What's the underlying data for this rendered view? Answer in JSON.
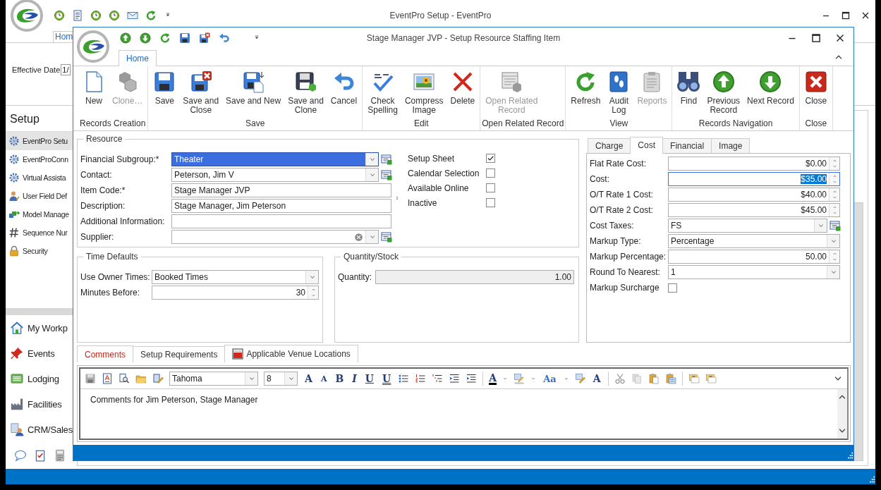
{
  "background_window": {
    "title": "EventPro Setup - EventPro",
    "tab": "Hom",
    "effective_date_label": "Effective Date",
    "effective_date_value": "1/",
    "sidebar_title": "Setup",
    "setup_items": [
      {
        "label": "EventPro Setu",
        "selected": true
      },
      {
        "label": "EventProConn",
        "selected": false
      },
      {
        "label": "Virtual Assista",
        "selected": false
      },
      {
        "label": "User Field Def",
        "selected": false
      },
      {
        "label": "Model Manage",
        "selected": false
      },
      {
        "label": "Sequence Nur",
        "selected": false
      },
      {
        "label": "Security",
        "selected": false
      }
    ],
    "nav_items": [
      "My Workp",
      "Events",
      "Lodging",
      "Facilities",
      "CRM/Sales"
    ]
  },
  "dialog": {
    "title": "Stage Manager JVP - Setup Resource Staffing Item",
    "tabs": [
      {
        "label": "Home",
        "selected": true
      }
    ],
    "ribbon": [
      {
        "label": "Records Creation",
        "buttons": [
          {
            "label": "New",
            "kind": "new",
            "disabled": false
          },
          {
            "label": "Clone…",
            "kind": "clone",
            "disabled": true
          }
        ]
      },
      {
        "label": "Save",
        "buttons": [
          {
            "label": "Save",
            "kind": "save",
            "disabled": false
          },
          {
            "label": "Save and\nClose",
            "kind": "save_close",
            "disabled": false
          },
          {
            "label": "Save and New",
            "kind": "save_new",
            "disabled": false
          },
          {
            "label": "Save and\nClone",
            "kind": "save_clone",
            "disabled": false
          },
          {
            "label": "Cancel",
            "kind": "cancel",
            "disabled": false
          }
        ]
      },
      {
        "label": "Edit",
        "buttons": [
          {
            "label": "Check\nSpelling",
            "kind": "spell",
            "disabled": false
          },
          {
            "label": "Compress\nImage",
            "kind": "image",
            "disabled": false
          },
          {
            "label": "Delete",
            "kind": "delete",
            "disabled": false
          }
        ]
      },
      {
        "label": "Open Related Record",
        "buttons": [
          {
            "label": "Open Related\nRecord",
            "kind": "open_related",
            "disabled": true
          }
        ]
      },
      {
        "label": "View",
        "buttons": [
          {
            "label": "Refresh",
            "kind": "refresh",
            "disabled": false
          },
          {
            "label": "Audit\nLog",
            "kind": "audit",
            "disabled": false
          },
          {
            "label": "Reports",
            "kind": "reports",
            "disabled": true
          }
        ]
      },
      {
        "label": "Records Navigation",
        "buttons": [
          {
            "label": "Find",
            "kind": "find",
            "disabled": false
          },
          {
            "label": "Previous\nRecord",
            "kind": "prev",
            "disabled": false
          },
          {
            "label": "Next Record",
            "kind": "next",
            "disabled": false
          }
        ]
      },
      {
        "label": "Close",
        "buttons": [
          {
            "label": "Close",
            "kind": "close",
            "disabled": false
          }
        ]
      }
    ]
  },
  "resource": {
    "title": "Resource",
    "fields": [
      {
        "label": "Financial Subgroup:*",
        "kind": "combo_lookup",
        "value": "Theater",
        "focused": true
      },
      {
        "label": "Contact:",
        "kind": "combo_lookup",
        "value": "Peterson, Jim V",
        "focused": false
      },
      {
        "label": "Item Code:*",
        "kind": "text",
        "value": "Stage Manager JVP",
        "focused": false
      },
      {
        "label": "Description:",
        "kind": "text",
        "value": "Stage Manager, Jim Peterson",
        "focused": false
      },
      {
        "label": "Additional Information:",
        "kind": "text",
        "focused": false
      },
      {
        "label": "Supplier:",
        "kind": "combo_clear_lookup",
        "focused": false
      }
    ],
    "checks": [
      {
        "label": "Setup Sheet",
        "checked": true
      },
      {
        "label": "Calendar Selection",
        "checked": false
      },
      {
        "label": "Available Online",
        "checked": false
      },
      {
        "label": "Inactive",
        "checked": false
      }
    ]
  },
  "time_defaults": {
    "title": "Time Defaults",
    "fields": [
      {
        "label": "Use Owner Times:",
        "kind": "combo",
        "value": "Booked Times",
        "focused": false
      },
      {
        "label": "Minutes Before:",
        "kind": "spin",
        "value": "30",
        "focused": false
      }
    ]
  },
  "quantity_stock": {
    "title": "Quantity/Stock",
    "fields": [
      {
        "label": "Quantity:",
        "kind": "readonly",
        "value": "1.00",
        "focused": false
      }
    ]
  },
  "cost_panel": {
    "tabs": [
      {
        "label": "Charge",
        "selected": false
      },
      {
        "label": "Cost",
        "selected": true
      },
      {
        "label": "Financial",
        "selected": false
      },
      {
        "label": "Image",
        "selected": false
      }
    ],
    "fields": [
      {
        "label": "Flat Rate Cost:",
        "kind": "spin",
        "value": "$0.00",
        "focused": false
      },
      {
        "label": "Cost:",
        "kind": "spin",
        "value": "$35.00",
        "focused": true
      },
      {
        "label": "O/T Rate 1 Cost:",
        "kind": "spin",
        "value": "$40.00",
        "focused": false
      },
      {
        "label": "O/T Rate 2 Cost:",
        "kind": "spin",
        "value": "$45.00",
        "focused": false
      },
      {
        "label": "Cost Taxes:",
        "kind": "combo_lookup",
        "value": "FS",
        "focused": false
      },
      {
        "label": "Markup Type:",
        "kind": "combo",
        "value": "Percentage",
        "focused": false
      },
      {
        "label": "Markup Percentage:",
        "kind": "spin",
        "value": "50.00",
        "focused": false
      },
      {
        "label": "Round To Nearest:",
        "kind": "combo",
        "value": "1",
        "focused": false
      },
      {
        "label": "Markup Surcharge",
        "kind": "checkbox",
        "checked": false,
        "focused": false
      }
    ]
  },
  "bottom_tabs": [
    {
      "label": "Comments",
      "selected": true
    },
    {
      "label": "Setup Requirements",
      "selected": false
    },
    {
      "label": "Applicable Venue Locations",
      "selected": false
    }
  ],
  "editor": {
    "font": "Tahoma",
    "size": "8",
    "glyphs": [
      {
        "text": "A",
        "kind": "grow"
      },
      {
        "text": "A",
        "kind": "shrink"
      },
      {
        "text": "B",
        "kind": "bold"
      },
      {
        "text": "I",
        "kind": "italic"
      },
      {
        "text": "U",
        "kind": "underline"
      },
      {
        "text": "U",
        "kind": "double_underline"
      },
      {
        "text": "A",
        "kind": "font_color"
      },
      {
        "text": "Aa",
        "kind": "case"
      },
      {
        "text": "A",
        "kind": "clear"
      }
    ],
    "content": "Comments for Jim Peterson, Stage Manager"
  }
}
